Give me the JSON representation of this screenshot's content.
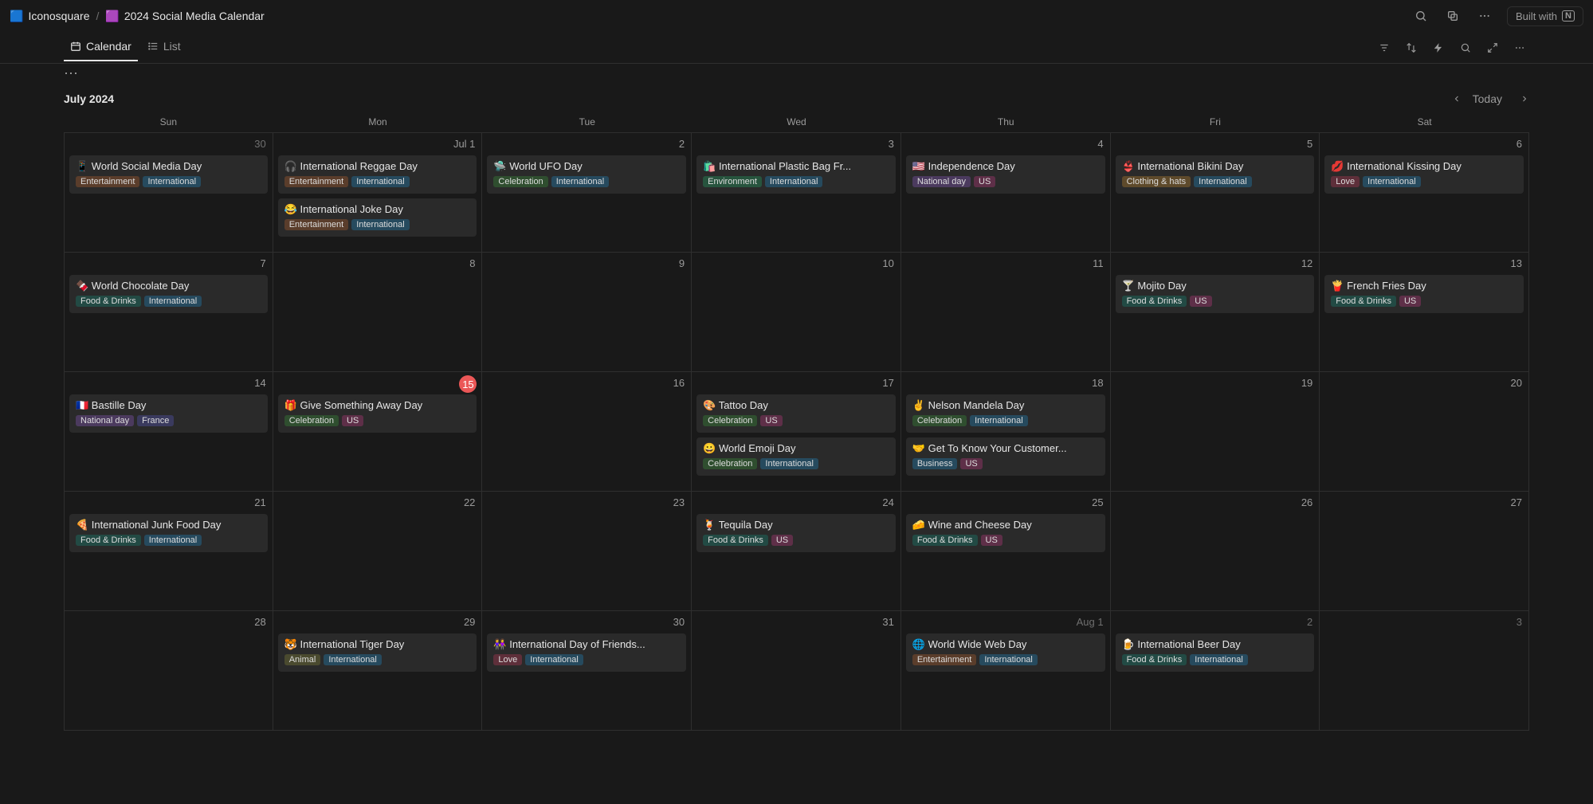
{
  "header": {
    "workspace": "Iconosquare",
    "workspace_emoji": "🟦",
    "page": "2024 Social Media Calendar",
    "page_emoji": "🟪",
    "built_with": "Built with",
    "built_with_logo": "N"
  },
  "views": {
    "calendar": "Calendar",
    "list": "List"
  },
  "calendar": {
    "month_label": "July 2024",
    "today_label": "Today",
    "weekdays": [
      "Sun",
      "Mon",
      "Tue",
      "Wed",
      "Thu",
      "Fri",
      "Sat"
    ]
  },
  "grid": {
    "cells": [
      {
        "date": "30",
        "outside": true,
        "events": [
          {
            "title": "📱  World Social Media Day",
            "tags": [
              "Entertainment",
              "International"
            ]
          }
        ]
      },
      {
        "date": "Jul 1",
        "events": [
          {
            "title": "🎧  International Reggae Day",
            "tags": [
              "Entertainment",
              "International"
            ]
          },
          {
            "title": "😂  International Joke Day",
            "tags": [
              "Entertainment",
              "International"
            ]
          }
        ]
      },
      {
        "date": "2",
        "events": [
          {
            "title": "🛸  World UFO Day",
            "tags": [
              "Celebration",
              "International"
            ]
          }
        ]
      },
      {
        "date": "3",
        "events": [
          {
            "title": "🛍️  International Plastic Bag Fr...",
            "tags": [
              "Environment",
              "International"
            ]
          }
        ]
      },
      {
        "date": "4",
        "events": [
          {
            "title": "🇺🇸  Independence Day",
            "tags": [
              "National day",
              "US"
            ]
          }
        ]
      },
      {
        "date": "5",
        "events": [
          {
            "title": "👙  International Bikini Day",
            "tags": [
              "Clothing & hats",
              "International"
            ]
          }
        ]
      },
      {
        "date": "6",
        "events": [
          {
            "title": "💋  International Kissing Day",
            "tags": [
              "Love",
              "International"
            ]
          }
        ]
      },
      {
        "date": "7",
        "events": [
          {
            "title": "🍫  World Chocolate Day",
            "tags": [
              "Food & Drinks",
              "International"
            ]
          }
        ]
      },
      {
        "date": "8",
        "events": []
      },
      {
        "date": "9",
        "events": []
      },
      {
        "date": "10",
        "events": []
      },
      {
        "date": "11",
        "events": []
      },
      {
        "date": "12",
        "events": [
          {
            "title": "🍸  Mojito Day",
            "tags": [
              "Food & Drinks",
              "US"
            ]
          }
        ]
      },
      {
        "date": "13",
        "events": [
          {
            "title": "🍟  French Fries Day",
            "tags": [
              "Food & Drinks",
              "US"
            ]
          }
        ]
      },
      {
        "date": "14",
        "events": [
          {
            "title": "🇫🇷  Bastille Day",
            "tags": [
              "National day",
              "France"
            ]
          }
        ]
      },
      {
        "date": "15",
        "today": true,
        "events": [
          {
            "title": "🎁  Give Something Away Day",
            "tags": [
              "Celebration",
              "US"
            ]
          }
        ]
      },
      {
        "date": "16",
        "events": []
      },
      {
        "date": "17",
        "events": [
          {
            "title": "🎨  Tattoo Day",
            "tags": [
              "Celebration",
              "US"
            ]
          },
          {
            "title": "😀  World Emoji Day",
            "tags": [
              "Celebration",
              "International"
            ]
          }
        ]
      },
      {
        "date": "18",
        "events": [
          {
            "title": "✌️  Nelson Mandela Day",
            "tags": [
              "Celebration",
              "International"
            ]
          },
          {
            "title": "🤝  Get To Know Your Customer...",
            "tags": [
              "Business",
              "US"
            ]
          }
        ]
      },
      {
        "date": "19",
        "events": []
      },
      {
        "date": "20",
        "events": []
      },
      {
        "date": "21",
        "events": [
          {
            "title": "🍕  International Junk Food Day",
            "tags": [
              "Food & Drinks",
              "International"
            ]
          }
        ]
      },
      {
        "date": "22",
        "events": []
      },
      {
        "date": "23",
        "events": []
      },
      {
        "date": "24",
        "events": [
          {
            "title": "🍹  Tequila Day",
            "tags": [
              "Food & Drinks",
              "US"
            ]
          }
        ]
      },
      {
        "date": "25",
        "events": [
          {
            "title": "🧀  Wine and Cheese Day",
            "tags": [
              "Food & Drinks",
              "US"
            ]
          }
        ]
      },
      {
        "date": "26",
        "events": []
      },
      {
        "date": "27",
        "events": []
      },
      {
        "date": "28",
        "events": []
      },
      {
        "date": "29",
        "events": [
          {
            "title": "🐯  International Tiger Day",
            "tags": [
              "Animal",
              "International"
            ]
          }
        ]
      },
      {
        "date": "30",
        "events": [
          {
            "title": "👭  International Day of Friends...",
            "tags": [
              "Love",
              "International"
            ]
          }
        ]
      },
      {
        "date": "31",
        "events": []
      },
      {
        "date": "Aug 1",
        "outside": true,
        "events": [
          {
            "title": "🌐  World Wide Web Day",
            "tags": [
              "Entertainment",
              "International"
            ]
          }
        ]
      },
      {
        "date": "2",
        "outside": true,
        "events": [
          {
            "title": "🍺  International Beer Day",
            "tags": [
              "Food & Drinks",
              "International"
            ]
          }
        ]
      },
      {
        "date": "3",
        "outside": true,
        "events": []
      }
    ]
  }
}
